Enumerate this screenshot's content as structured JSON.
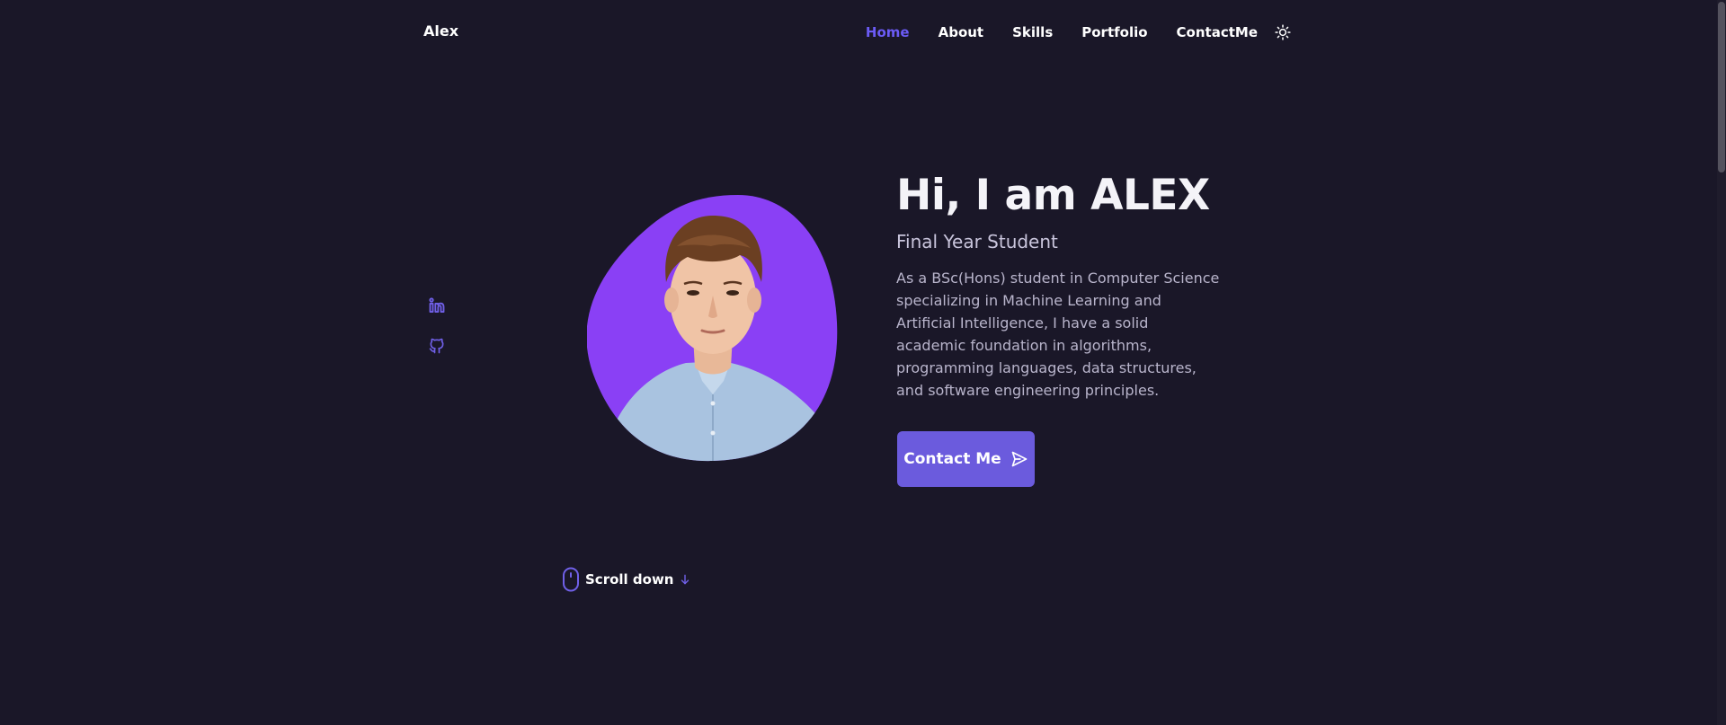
{
  "header": {
    "brand": "Alex",
    "nav": [
      {
        "label": "Home",
        "active": true
      },
      {
        "label": "About",
        "active": false
      },
      {
        "label": "Skills",
        "active": false
      },
      {
        "label": "Portfolio",
        "active": false
      },
      {
        "label": "ContactMe",
        "active": false
      }
    ],
    "theme_toggle_icon": "sun-icon"
  },
  "social": [
    {
      "icon": "linkedin-icon"
    },
    {
      "icon": "github-icon"
    }
  ],
  "hero": {
    "title": "Hi, I am ALEX",
    "subtitle": "Final Year Student",
    "description": "As a BSc(Hons) student in Computer Science specializing in Machine Learning and Artificial Intelligence, I have a solid academic foundation in algorithms, programming languages, data structures, and software engineering principles.",
    "button_label": "Contact Me",
    "button_icon": "send-icon",
    "photo_icon": "profile-photo"
  },
  "scroll": {
    "label": "Scroll down",
    "mouse_icon": "mouse-icon",
    "arrow_icon": "arrow-down-icon"
  },
  "colors": {
    "background": "#1a1728",
    "accent": "#6b5bf5",
    "blob": "#8a40f5",
    "button": "#6b5bdd"
  }
}
